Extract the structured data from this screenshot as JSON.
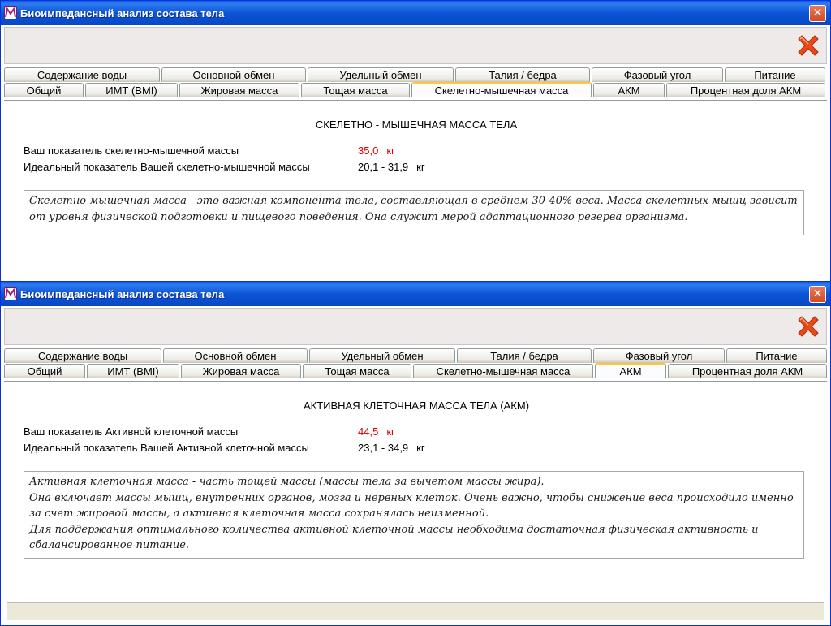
{
  "window1": {
    "title": "Биоимпедансный анализ состава тела",
    "tabs_row1": [
      "Содержание воды",
      "Основной обмен",
      "Удельный обмен",
      "Талия / бедра",
      "Фазовый угол",
      "Питание"
    ],
    "tabs_row2": [
      "Общий",
      "ИМТ (BMI)",
      "Жировая масса",
      "Тощая масса",
      "Скелетно-мышечная масса",
      "АКМ",
      "Процентная доля АКМ"
    ],
    "active_tab": "Скелетно-мышечная масса",
    "section_title": "СКЕЛЕТНО - МЫШЕЧНАЯ МАССА ТЕЛА",
    "your_label": "Ваш показатель скелетно-мышечной массы",
    "your_value": "35,0",
    "unit": "кг",
    "ideal_label": "Идеальный показатель Вашей скелетно-мышечной массы",
    "ideal_value": "20,1 - 31,9",
    "description": [
      "Скелетно-мышечная масса - это важная компонента тела, составляющая в среднем 30-40% веса. Масса скелетных мышц зависит от уровня физической подготовки и пищевого поведения. Она служит мерой адаптационного резерва организма."
    ]
  },
  "window2": {
    "title": "Биоимпедансный анализ состава тела",
    "tabs_row1": [
      "Содержание воды",
      "Основной обмен",
      "Удельный обмен",
      "Талия / бедра",
      "Фазовый угол",
      "Питание"
    ],
    "tabs_row2": [
      "Общий",
      "ИМТ (BMI)",
      "Жировая масса",
      "Тощая масса",
      "Скелетно-мышечная масса",
      "АКМ",
      "Процентная доля АКМ"
    ],
    "active_tab": "АКМ",
    "section_title": "АКТИВНАЯ КЛЕТОЧНАЯ МАССА ТЕЛА  (АКМ)",
    "your_label": "Ваш показатель Активной клеточной массы",
    "your_value": "44,5",
    "unit": "кг",
    "ideal_label": "Идеальный показатель Вашей Активной клеточной массы",
    "ideal_value": "23,1 - 34,9",
    "description": [
      "Активная клеточная масса - часть тощей массы (массы тела за вычетом массы жира).",
      "Она включает массы мышц, внутренних органов, мозга и нервных клеток. Очень важно, чтобы снижение веса происходило именно за счет жировой массы, а активная клеточная масса сохранялась неизменной.",
      "Для поддержания оптимального количества активной клеточной массы необходима достаточная физическая активность и сбалансированное питание."
    ]
  },
  "icons": {
    "app": "app-logo-icon",
    "window_close": "window-close-icon",
    "toolbar_close": "red-x-close-icon"
  },
  "colors": {
    "titlebar": "#0a55d6",
    "highlight_value": "#e00000",
    "active_tab_accent": "#ffc83c",
    "close_x": "#e84a1a"
  }
}
